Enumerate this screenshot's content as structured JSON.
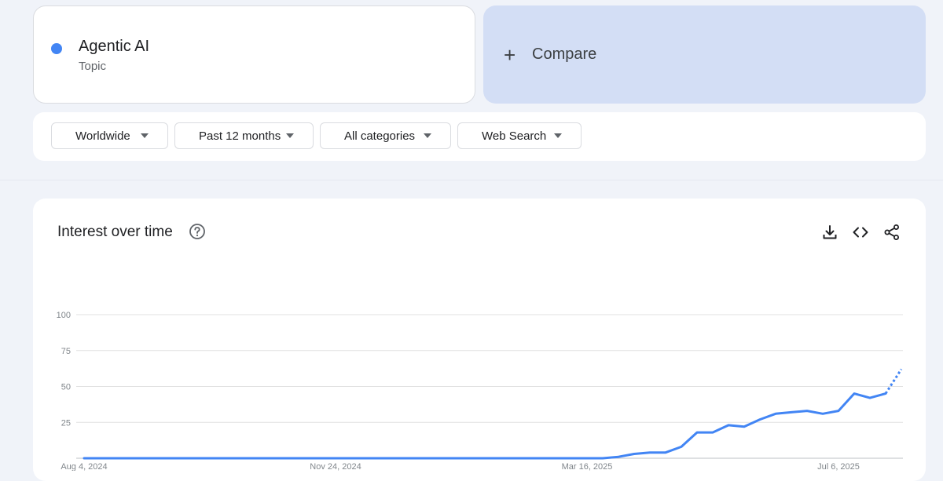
{
  "search_term": {
    "name": "Agentic AI",
    "type": "Topic",
    "color": "#4285f4"
  },
  "compare": {
    "label": "Compare",
    "plus": "+",
    "bg": "#d3def5"
  },
  "filters": {
    "region": "Worldwide",
    "period": "Past 12 months",
    "category": "All categories",
    "property": "Web Search"
  },
  "chart": {
    "title": "Interest over time",
    "icons": [
      "help-icon",
      "download-icon",
      "embed-icon",
      "share-icon"
    ]
  },
  "chart_data": {
    "type": "line",
    "title": "Interest over time",
    "xlabel": "",
    "ylabel": "",
    "ylim": [
      0,
      100
    ],
    "yticks": [
      25,
      50,
      75,
      100
    ],
    "grid": true,
    "x_tick_labels": [
      "Aug 4, 2024",
      "Nov 24, 2024",
      "Mar 16, 2025",
      "Jul 6, 2025"
    ],
    "x_tick_indices": [
      0,
      16,
      32,
      48
    ],
    "series": [
      {
        "color": "#4285f4",
        "values": [
          0,
          0,
          0,
          0,
          0,
          0,
          0,
          0,
          0,
          0,
          0,
          0,
          0,
          0,
          0,
          0,
          0,
          0,
          0,
          0,
          0,
          0,
          0,
          0,
          0,
          0,
          0,
          0,
          0,
          0,
          0,
          0,
          0,
          0,
          1,
          3,
          4,
          4,
          8,
          18,
          18,
          23,
          22,
          27,
          31,
          32,
          33,
          31,
          33,
          45,
          42,
          45,
          62
        ],
        "partial_from_index": 51
      }
    ]
  }
}
